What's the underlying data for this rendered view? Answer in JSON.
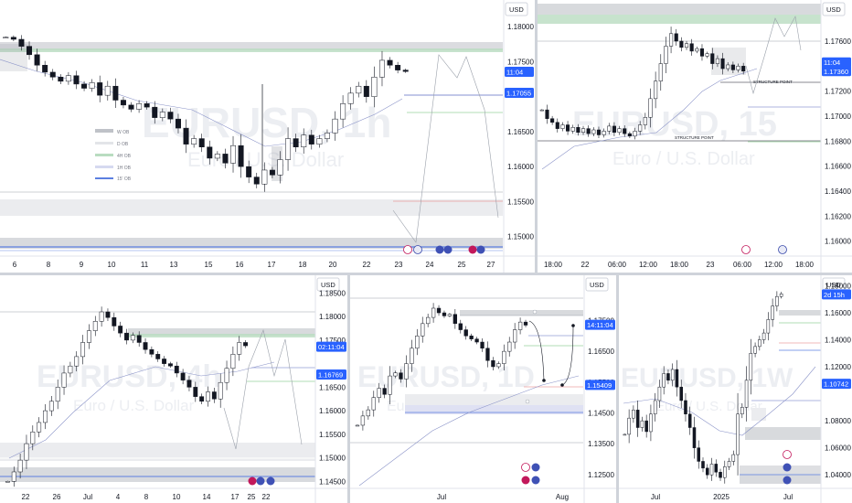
{
  "chart_data": [
    {
      "type": "candlestick",
      "watermark_symbol": "EURUSD, 1h",
      "watermark_name": "Euro / U.S. Dollar",
      "currency": "USD",
      "yticks": [
        "1.18000",
        "1.17500",
        "1.16500",
        "1.16000",
        "1.15500",
        "1.15000"
      ],
      "ylim": [
        1.1472,
        1.1833
      ],
      "xticks": [
        "6",
        "8",
        "9",
        "10",
        "11",
        "13",
        "15",
        "16",
        "17",
        "18",
        "20",
        "22",
        "23",
        "24",
        "25",
        "27"
      ],
      "price_tags": [
        {
          "label": "11:04",
          "value": 1.17355
        },
        {
          "label": "1.17055",
          "value": 1.17055
        }
      ],
      "legend": [
        "W OB",
        "D OB",
        "4H OB",
        "1H OB",
        "15' OB"
      ],
      "close_path": [
        1.1785,
        1.1782,
        1.1772,
        1.176,
        1.1745,
        1.1735,
        1.1728,
        1.1722,
        1.173,
        1.1718,
        1.1712,
        1.172,
        1.1702,
        1.1715,
        1.1695,
        1.1688,
        1.1682,
        1.169,
        1.1685,
        1.167,
        1.1678,
        1.1668,
        1.1655,
        1.1632,
        1.164,
        1.1628,
        1.1612,
        1.1618,
        1.1605,
        1.163,
        1.16,
        1.1585,
        1.1575,
        1.1595,
        1.1588,
        1.161,
        1.164,
        1.1628,
        1.1645,
        1.1632,
        1.164,
        1.1648,
        1.1668,
        1.169,
        1.1705,
        1.1715,
        1.17,
        1.1728,
        1.1752,
        1.1745,
        1.1738,
        1.1736
      ]
    },
    {
      "type": "candlestick",
      "watermark_symbol": "EURUSD, 15",
      "watermark_name": "Euro / U.S. Dollar",
      "currency": "USD",
      "yticks": [
        "1.17600",
        "1.17200",
        "1.17000",
        "1.16800",
        "1.16600",
        "1.16400",
        "1.16200",
        "1.16000"
      ],
      "ylim": [
        1.1588,
        1.179
      ],
      "xticks": [
        "18:00",
        "22",
        "06:00",
        "12:00",
        "18:00",
        "23",
        "06:00",
        "12:00",
        "18:00"
      ],
      "price_tags": [
        {
          "label": "11:04",
          "value": 1.1743
        },
        {
          "label": "1.17360",
          "value": 1.1736
        }
      ],
      "annotations": [
        "STRUCTURE POINT",
        "STRUCTURE POINT"
      ],
      "close_path": [
        1.1705,
        1.1698,
        1.1695,
        1.169,
        1.1693,
        1.1688,
        1.1691,
        1.1687,
        1.169,
        1.1686,
        1.1689,
        1.1685,
        1.1688,
        1.1692,
        1.1687,
        1.169,
        1.1686,
        1.1684,
        1.1688,
        1.1693,
        1.1699,
        1.1714,
        1.1728,
        1.1742,
        1.1756,
        1.1766,
        1.176,
        1.1755,
        1.1758,
        1.1752,
        1.1754,
        1.1748,
        1.175,
        1.1742,
        1.1746,
        1.1738,
        1.1741,
        1.1737,
        1.174,
        1.1736
      ]
    },
    {
      "type": "candlestick",
      "watermark_symbol": "EURUSD, 4h",
      "watermark_name": "Euro / U.S. Dollar",
      "currency": "USD",
      "yticks": [
        "1.18500",
        "1.18000",
        "1.17500",
        "1.16500",
        "1.16000",
        "1.15500",
        "1.15000",
        "1.14500"
      ],
      "ylim": [
        1.1435,
        1.188
      ],
      "xticks": [
        "22",
        "26",
        "Jul",
        "4",
        "8",
        "10",
        "14",
        "17",
        "22",
        "25"
      ],
      "price_tags": [
        {
          "label": "02:11:04",
          "value": 1.1736
        },
        {
          "label": "1.16769",
          "value": 1.16769
        }
      ],
      "close_path": [
        1.145,
        1.147,
        1.1495,
        1.153,
        1.1555,
        1.1575,
        1.16,
        1.162,
        1.165,
        1.168,
        1.1695,
        1.1715,
        1.1745,
        1.177,
        1.179,
        1.181,
        1.1798,
        1.178,
        1.1765,
        1.175,
        1.176,
        1.1745,
        1.173,
        1.172,
        1.171,
        1.17,
        1.1695,
        1.168,
        1.1665,
        1.165,
        1.163,
        1.162,
        1.164,
        1.1625,
        1.166,
        1.169,
        1.172,
        1.1745,
        1.1738
      ]
    },
    {
      "type": "candlestick",
      "watermark_symbol": "EURUSD, 1D",
      "watermark_name": "Euro / U.S. Dollar",
      "currency": "USD",
      "yticks": [
        "1.17500",
        "1.16500",
        "1.15500",
        "1.14500",
        "1.13500",
        "1.12500"
      ],
      "ylim": [
        1.1205,
        1.1885
      ],
      "xticks": [
        "Jul",
        "Aug"
      ],
      "price_tags": [
        {
          "label": "14:11:04",
          "value": 1.1736
        },
        {
          "label": "1.15409",
          "value": 1.15409
        }
      ],
      "close_path": [
        1.141,
        1.144,
        1.146,
        1.15,
        1.153,
        1.151,
        1.157,
        1.158,
        1.156,
        1.161,
        1.166,
        1.17,
        1.174,
        1.176,
        1.179,
        1.1775,
        1.1765,
        1.177,
        1.174,
        1.172,
        1.17,
        1.169,
        1.168,
        1.166,
        1.162,
        1.16,
        1.161,
        1.165,
        1.168,
        1.172,
        1.1745,
        1.1735
      ]
    },
    {
      "type": "candlestick",
      "watermark_symbol": "EURUSD, 1W",
      "watermark_name": "Euro / U.S. Dollar",
      "currency": "USD",
      "yticks": [
        "1.18000",
        "1.16000",
        "1.14000",
        "1.12000",
        "1.08000",
        "1.06000",
        "1.04000"
      ],
      "ylim": [
        1.03,
        1.185
      ],
      "xticks": [
        "Jul",
        "2025",
        "Jul"
      ],
      "price_tags": [
        {
          "label": "2d 15h",
          "value": 1.1736
        },
        {
          "label": "1.10742",
          "value": 1.10742
        }
      ],
      "close_path": [
        1.07,
        1.082,
        1.088,
        1.075,
        1.08,
        1.072,
        1.085,
        1.095,
        1.105,
        1.115,
        1.11,
        1.118,
        1.105,
        1.095,
        1.085,
        1.075,
        1.06,
        1.05,
        1.045,
        1.04,
        1.048,
        1.042,
        1.038,
        1.046,
        1.05,
        1.055,
        1.085,
        1.09,
        1.11,
        1.13,
        1.135,
        1.14,
        1.145,
        1.155,
        1.165,
        1.172,
        1.174
      ]
    }
  ]
}
